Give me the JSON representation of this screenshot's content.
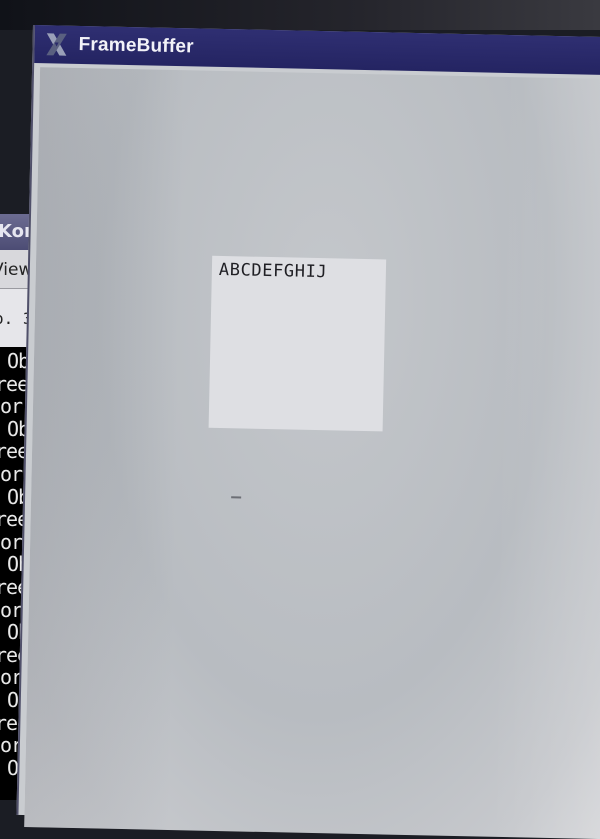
{
  "desktop": {
    "background_color": "#1b1d24"
  },
  "konsole": {
    "title_fragment": "Kon",
    "menu_fragment": "View",
    "tab_fragment": "o. 3",
    "output_lines": [
      " Ob",
      "ree",
      "or",
      " Ob",
      "ree",
      "or",
      " Ob",
      "ree",
      "or",
      " Ob",
      "ree",
      "or",
      " Ob",
      "ree",
      "or",
      " Ob",
      "ree",
      "or",
      " Ob"
    ],
    "text_color": "#e8e8e8",
    "background_color": "#000000"
  },
  "framebuffer": {
    "window_title": "FrameBuffer",
    "app_icon": "x-window-icon",
    "titlebar_color": "#2a2a6a",
    "canvas_color": "#bfc2c6",
    "panel": {
      "text": "ABCDEFGHIJ",
      "background_color": "#dedfe3"
    }
  }
}
